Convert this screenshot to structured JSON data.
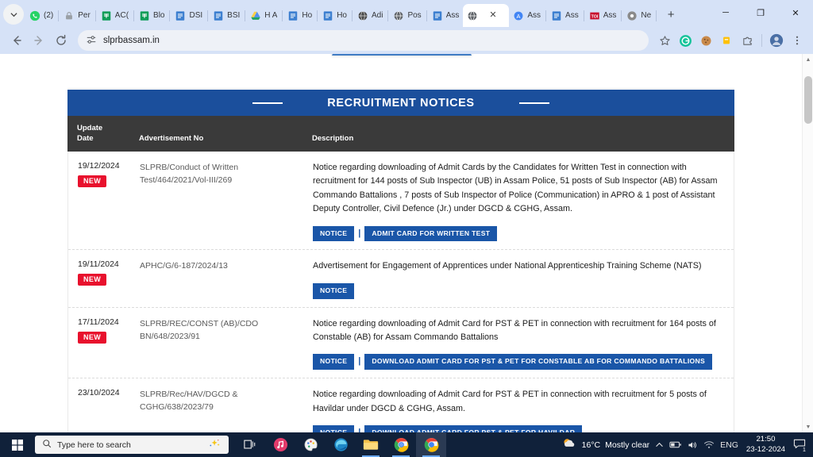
{
  "browser": {
    "tabs": [
      {
        "label": "(2)",
        "icon": "whatsapp-icon",
        "active": false
      },
      {
        "label": "Per",
        "icon": "lock-icon",
        "active": false
      },
      {
        "label": "AC(",
        "icon": "sheets-icon",
        "active": false
      },
      {
        "label": "Blo",
        "icon": "sheets-icon",
        "active": false
      },
      {
        "label": "DSI",
        "icon": "docs-icon",
        "active": false
      },
      {
        "label": "BSI",
        "icon": "docs-icon",
        "active": false
      },
      {
        "label": "H A",
        "icon": "drive-icon",
        "active": false
      },
      {
        "label": "Ho",
        "icon": "docs-icon",
        "active": false
      },
      {
        "label": "Ho",
        "icon": "docs-icon",
        "active": false
      },
      {
        "label": "Adi",
        "icon": "globe-dark-icon",
        "active": false
      },
      {
        "label": "Pos",
        "icon": "globe-icon",
        "active": false
      },
      {
        "label": "Ass",
        "icon": "docs-icon",
        "active": false
      },
      {
        "label": "",
        "icon": "globe-icon",
        "active": true
      },
      {
        "label": "Ass",
        "icon": "circle-a-icon",
        "active": false
      },
      {
        "label": "Ass",
        "icon": "docs-icon",
        "active": false
      },
      {
        "label": "Ass",
        "icon": "toi-icon",
        "active": false
      },
      {
        "label": "Ne",
        "icon": "chrome-icon",
        "active": false
      }
    ],
    "new_tab_label": "+",
    "window_controls": {
      "minimize": "─",
      "maximize": "❐",
      "close": "✕"
    },
    "toolbar": {
      "back": "←",
      "forward": "→",
      "reload": "⟳",
      "site_settings_icon": "tune-icon",
      "url": "slprbassam.in",
      "bookmark_icon": "star-icon",
      "extensions": [
        "grammarly-icon",
        "cookie-icon",
        "password-icon",
        "extensions-icon"
      ],
      "profile_icon": "profile-avatar",
      "menu_icon": "three-dot-menu"
    }
  },
  "page": {
    "panel": {
      "title": "RECRUITMENT NOTICES",
      "header_color": "#1b4f9c",
      "columns": {
        "date_line1": "Update",
        "date_line2": "Date",
        "advertisement": "Advertisement No",
        "description": "Description"
      },
      "badge_new_label": "NEW",
      "badge_new_color": "#e8112d",
      "button_color": "#1a56a8",
      "rows": [
        {
          "date": "19/12/2024",
          "is_new": true,
          "advertisement_no": "SLPRB/Conduct of Written Test/464/2021/Vol-III/269",
          "description": "Notice regarding downloading of Admit Cards by the Candidates for Written Test in connection with recruitment for 144 posts of Sub Inspector (UB) in Assam Police, 51 posts of Sub Inspector (AB) for Assam Commando Battalions , 7 posts of Sub Inspector of Police (Communication) in APRO & 1 post of Assistant Deputy Controller, Civil Defence (Jr.) under DGCD & CGHG, Assam.",
          "buttons": [
            "NOTICE",
            "ADMIT CARD FOR WRITTEN TEST"
          ]
        },
        {
          "date": "19/11/2024",
          "is_new": true,
          "advertisement_no": "APHC/G/6-187/2024/13",
          "description": "Advertisement for Engagement of Apprentices under National Apprenticeship Training Scheme (NATS)",
          "buttons": [
            "NOTICE"
          ]
        },
        {
          "date": "17/11/2024",
          "is_new": true,
          "advertisement_no": "SLPRB/REC/CONST (AB)/CDO BN/648/2023/91",
          "description": "Notice regarding downloading of Admit Card for PST & PET in connection with recruitment for 164 posts of Constable (AB) for Assam Commando Battalions",
          "buttons": [
            "NOTICE",
            "DOWNLOAD ADMIT CARD FOR PST & PET FOR CONSTABLE AB FOR COMMANDO BATTALIONS"
          ]
        },
        {
          "date": "23/10/2024",
          "is_new": false,
          "advertisement_no": "SLPRB/Rec/HAV/DGCD & CGHG/638/2023/79",
          "description": "Notice regarding downloading of Admit Card for PST & PET in connection with recruitment for 5 posts of Havildar under DGCD & CGHG, Assam.",
          "buttons": [
            "NOTICE",
            "DOWNLOAD ADMIT CARD FOR PST & PET FOR HAVILDAR"
          ]
        }
      ]
    }
  },
  "taskbar": {
    "start_icon": "windows-start-icon",
    "search_placeholder": "Type here to search",
    "search_icon": "search-icon",
    "sparkle_icon": "sparkle-icon",
    "pinned": [
      {
        "name": "task-view-icon"
      },
      {
        "name": "itunes-icon"
      },
      {
        "name": "paint-icon"
      },
      {
        "name": "edge-icon"
      },
      {
        "name": "file-explorer-icon"
      },
      {
        "name": "chrome-icon"
      },
      {
        "name": "chrome-active-icon"
      }
    ],
    "tray": {
      "weather_icon": "partly-cloudy-icon",
      "temperature": "16°C",
      "condition": "Mostly clear",
      "chevron_icon": "chevron-up-icon",
      "battery_icon": "battery-icon",
      "volume_icon": "volume-icon",
      "network_icon": "wifi-icon",
      "language": "ENG",
      "time": "21:50",
      "date": "23-12-2024",
      "notification_icon": "notification-icon",
      "notification_count": "1"
    }
  }
}
